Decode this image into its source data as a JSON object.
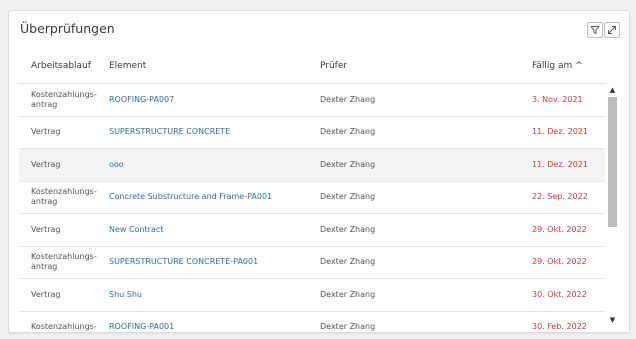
{
  "panel": {
    "title": "Überprüfungen",
    "filter_icon": "filter-icon",
    "expand_icon": "expand-icon"
  },
  "columns": [
    "Arbeitsablauf",
    "Element",
    "Prüfer",
    "Fällig am ^"
  ],
  "rows": [
    {
      "workflow": "Kostenzahlungs-\nantrag",
      "element": "ROOFING-PA007",
      "reviewer": "Dexter Zhang",
      "due": "3. Nov. 2021"
    },
    {
      "workflow": "Vertrag",
      "element": "SUPERSTRUCTURE CONCRETE",
      "reviewer": "Dexter Zhang",
      "due": "11. Dez. 2021"
    },
    {
      "workflow": "Vertrag",
      "element": "ooo",
      "reviewer": "Dexter Zhang",
      "due": "11. Dez. 2021"
    },
    {
      "workflow": "Kostenzahlungs-\nantrag",
      "element": "Concrete Substructure and Frame-PA001",
      "reviewer": "Dexter Zhang",
      "due": "22. Sep. 2022"
    },
    {
      "workflow": "Vertrag",
      "element": "New Contract",
      "reviewer": "Dexter Zhang",
      "due": "29. Okt. 2022"
    },
    {
      "workflow": "Kostenzahlungs-\nantrag",
      "element": "SUPERSTRUCTURE CONCRETE-PA001",
      "reviewer": "Dexter Zhang",
      "due": "29. Okt. 2022"
    },
    {
      "workflow": "Vertrag",
      "element": "Shu Shu",
      "reviewer": "Dexter Zhang",
      "due": "30. Okt. 2022"
    },
    {
      "workflow": "Kostenzahlungs-",
      "element": "ROOFING-PA001",
      "reviewer": "Dexter Zhang",
      "due": "30. Feb. 2022"
    }
  ],
  "colors": {
    "link": "#2b6fae",
    "due": "#d23a3a"
  }
}
